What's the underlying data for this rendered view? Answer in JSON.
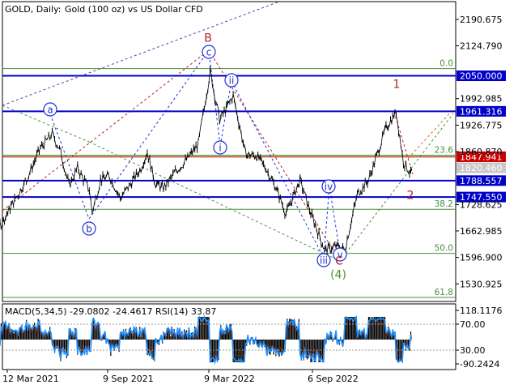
{
  "header": {
    "symbol": "GOLD, Daily:",
    "description": "Gold (100 oz) vs US Dollar CFD"
  },
  "colors": {
    "price_line": "#000000",
    "horizontal_blue": "#0000c8",
    "horizontal_brown": "#b0420f",
    "fib_green": "#4a8f3c",
    "wave_red": "#b22222",
    "wave_blue": "#1f2fd6",
    "macd_hist": "#000000",
    "rsi": "#1e90ff",
    "signal": "#cc2200"
  },
  "chart_data": [
    {
      "type": "line",
      "name": "price",
      "title": "",
      "y_ticks": [
        "2190.675",
        "2124.790",
        "1992.985",
        "1926.775",
        "1860.870",
        "1728.625",
        "1662.985",
        "1596.900",
        "1530.925"
      ],
      "x_ticks": [
        "12 Mar 2021",
        "9 Sep 2021",
        "9 Mar 2022",
        "6 Sep 2022"
      ],
      "ylim": [
        1487,
        2235
      ],
      "price_path": [
        [
          "2021-01-04",
          1728
        ],
        [
          "2021-01-25",
          1745
        ],
        [
          "2021-02-10",
          1700
        ],
        [
          "2021-03-01",
          1680
        ],
        [
          "2021-03-25",
          1740
        ],
        [
          "2021-04-15",
          1790
        ],
        [
          "2021-05-10",
          1870
        ],
        [
          "2021-05-31",
          1905
        ],
        [
          "2021-06-15",
          1860
        ],
        [
          "2021-06-30",
          1775
        ],
        [
          "2021-07-15",
          1820
        ],
        [
          "2021-08-05",
          1765
        ],
        [
          "2021-08-10",
          1710
        ],
        [
          "2021-08-25",
          1790
        ],
        [
          "2021-09-10",
          1800
        ],
        [
          "2021-09-29",
          1745
        ],
        [
          "2021-10-15",
          1775
        ],
        [
          "2021-11-05",
          1820
        ],
        [
          "2021-11-16",
          1860
        ],
        [
          "2021-12-01",
          1780
        ],
        [
          "2021-12-15",
          1770
        ],
        [
          "2022-01-05",
          1810
        ],
        [
          "2022-01-25",
          1840
        ],
        [
          "2022-02-15",
          1880
        ],
        [
          "2022-03-08",
          2060
        ],
        [
          "2022-03-25",
          1940
        ],
        [
          "2022-04-18",
          2000
        ],
        [
          "2022-05-10",
          1855
        ],
        [
          "2022-05-30",
          1850
        ],
        [
          "2022-06-15",
          1820
        ],
        [
          "2022-07-05",
          1765
        ],
        [
          "2022-07-21",
          1705
        ],
        [
          "2022-08-15",
          1790
        ],
        [
          "2022-09-01",
          1715
        ],
        [
          "2022-09-28",
          1615
        ],
        [
          "2022-10-20",
          1625
        ],
        [
          "2022-11-03",
          1617
        ],
        [
          "2022-11-25",
          1755
        ],
        [
          "2022-12-15",
          1790
        ],
        [
          "2023-01-15",
          1920
        ],
        [
          "2023-02-02",
          1960
        ],
        [
          "2023-02-15",
          1835
        ],
        [
          "2023-02-28",
          1805
        ],
        [
          "2023-03-03",
          1822
        ]
      ],
      "levels": [
        {
          "price": 2050.0,
          "label": "2050.000",
          "style": "blue"
        },
        {
          "price": 1961.316,
          "label": "1961.316",
          "style": "blue"
        },
        {
          "price": 1847.941,
          "label": "1847.941",
          "style": "brown"
        },
        {
          "price": 1820.46,
          "label": "1820.460",
          "style": "gray"
        },
        {
          "price": 1788.557,
          "label": "1788.557",
          "style": "blue"
        },
        {
          "price": 1747.55,
          "label": "1747.550",
          "style": "blue"
        }
      ],
      "fib_levels": [
        {
          "price": 2068,
          "label": "0.0"
        },
        {
          "price": 1852,
          "label": "23.6"
        },
        {
          "price": 1717,
          "label": "38.2"
        },
        {
          "price": 1607,
          "label": "50.0"
        },
        {
          "price": 1497,
          "label": "61.8"
        }
      ],
      "wave_labels": [
        {
          "text": "B",
          "circled": false,
          "color": "red"
        },
        {
          "text": "c",
          "circled": true,
          "color": "blue"
        },
        {
          "text": "a",
          "circled": true,
          "color": "blue"
        },
        {
          "text": "b",
          "circled": true,
          "color": "blue"
        },
        {
          "text": "ii",
          "circled": true,
          "color": "blue"
        },
        {
          "text": "i",
          "circled": true,
          "color": "blue"
        },
        {
          "text": "iv",
          "circled": true,
          "color": "blue"
        },
        {
          "text": "iii",
          "circled": true,
          "color": "blue"
        },
        {
          "text": "v",
          "circled": true,
          "color": "blue"
        },
        {
          "text": "C",
          "circled": false,
          "color": "red"
        },
        {
          "text": "(4)",
          "circled": false,
          "color": "green"
        },
        {
          "text": "1",
          "circled": false,
          "color": "red"
        },
        {
          "text": "2",
          "circled": false,
          "color": "red"
        }
      ]
    },
    {
      "type": "area",
      "name": "indicator",
      "title": "MACD(5,34,5) -29.0802 -24.4617 RSI(14) 33.87",
      "y_ticks": [
        "118.1176",
        "70.00",
        "30.00",
        "-90.2424"
      ]
    }
  ]
}
